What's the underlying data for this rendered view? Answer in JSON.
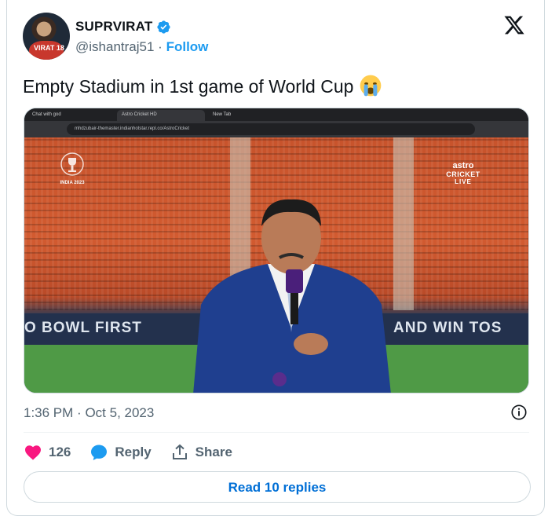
{
  "author": {
    "display_name": "SUPRVIRAT",
    "handle": "@ishantraj51",
    "separator": "·",
    "follow_label": "Follow",
    "jersey_number": "VIRAT 18"
  },
  "tweet": {
    "text": "Empty Stadium in 1st game of World Cup",
    "emoji": "crying-face-emoji"
  },
  "media": {
    "browser": {
      "tabs": [
        "Chat with god",
        "Astro Cricket HD",
        "New Tab"
      ],
      "url": "mhdzubair-themaster.indianhotstar.repl.co/AstroCricket"
    },
    "overlay": {
      "broadcaster_line1": "astro",
      "broadcaster_line2": "CRICKET",
      "broadcaster_line3": "LIVE",
      "event_logo_text": "INDIA 2023",
      "banner_left": "O BOWL FIRST",
      "banner_right": "AND WIN TOS"
    }
  },
  "meta": {
    "time": "1:36 PM",
    "separator": "·",
    "date": "Oct 5, 2023"
  },
  "actions": {
    "like_count": "126",
    "reply_label": "Reply",
    "share_label": "Share"
  },
  "read_replies_label": "Read 10 replies",
  "colors": {
    "accent": "#1d9bf0",
    "link": "#006fd6",
    "like": "#f91880",
    "muted": "#536471"
  }
}
